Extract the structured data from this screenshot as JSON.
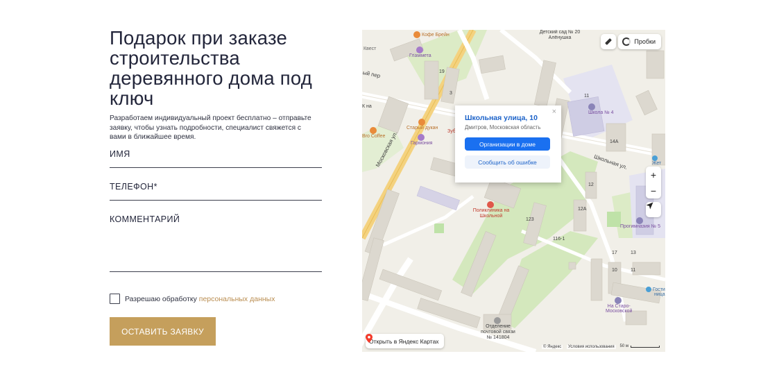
{
  "form": {
    "title": "Подарок при заказе строительства деревянного дома под ключ",
    "subtitle": "Разработаем индивидуальный проект бесплатно – отправьте заявку, чтобы узнать подробности, специалист свяжется с вами в ближайшее время.",
    "name_label": "ИМЯ",
    "phone_label": "ТЕЛЕФОН*",
    "comment_label": "КОММЕНТАРИЙ",
    "consent_text": "Разрешаю обработку ",
    "consent_link": "персональных данных",
    "consent_checked": false,
    "submit_label": "ОСТАВИТЬ ЗАЯВКУ",
    "colors": {
      "accent": "#c59f5c",
      "link": "#b98c4f",
      "text": "#23263b"
    }
  },
  "map": {
    "traffic_label": "Пробки",
    "ruler_icon": "ruler-icon",
    "zoom_in": "+",
    "zoom_out": "−",
    "popup": {
      "title": "Школьная улица, 10",
      "subtitle": "Дмитров, Московская область",
      "primary_button": "Организации в доме",
      "secondary_button": "Сообщить об ошибке",
      "close": "×"
    },
    "open_in_yandex": "Открыть в Яндекс Картах",
    "copyright": "© Яндекс",
    "terms": "Условия использования",
    "scale_label": "50 м",
    "streets": {
      "moskovskaya": "Московская ул.",
      "shkolnaya": "Школьная ул.",
      "per": "ый пер"
    },
    "pois": {
      "coffee_brain": "Кофе Брейн",
      "kvest": "Квест",
      "glinda": "Гламмета",
      "kindergarten": "Детский сад № 20 Алёнушка",
      "kindergarten_short": "№ 20 Алёнушка",
      "school": "Школа № 4",
      "stary_dukan": "Старый дукан",
      "zub": "Зуб",
      "garmonia": "Гармония",
      "bro_coffee": "Bro Coffee",
      "kna": "К на",
      "polyclinic": "Поликлиника на Школьной",
      "progimnazia": "Прогимназия № 5",
      "zhet": "Жет",
      "gostinitsa": "Гости",
      "gostinitsa2": "ница",
      "na_staro": "На Старо-",
      "moskovskoy": "Московской",
      "post_office": "Отделение почтовой связи № 141804"
    },
    "house_numbers": [
      "19",
      "3",
      "11",
      "14",
      "9",
      "12",
      "12А",
      "123",
      "116-1",
      "11",
      "14А",
      "10",
      "11",
      "17",
      "13"
    ]
  }
}
